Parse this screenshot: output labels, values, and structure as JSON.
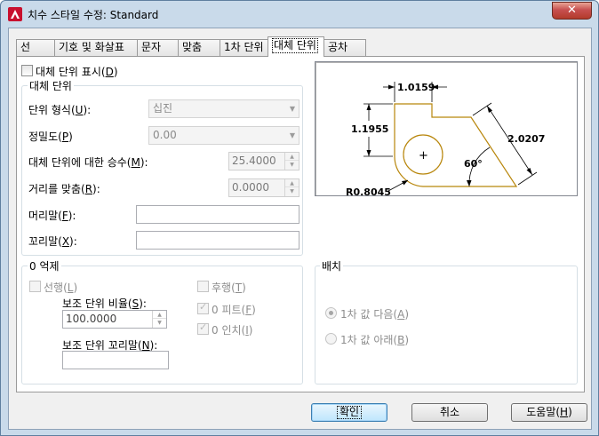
{
  "window": {
    "title": "치수 스타일 수정: Standard",
    "close_label": "✕",
    "accent_color": "#c9daea"
  },
  "tabs": [
    {
      "label": "선"
    },
    {
      "label": "기호 및 화살표"
    },
    {
      "label": "문자"
    },
    {
      "label": "맞춤"
    },
    {
      "label": "1차 단위"
    },
    {
      "label": "대체 단위",
      "active": true
    },
    {
      "label": "공차"
    }
  ],
  "alt_units": {
    "display_label": "대체 단위 표시(",
    "display_hotkey": "D",
    "display_checked": false,
    "group_title": "대체 단위",
    "unit_format_label": "단위 형식(",
    "unit_format_hotkey": "U",
    "unit_format_value": "십진",
    "precision_label": "정밀도(",
    "precision_hotkey": "P",
    "precision_value": "0.00",
    "multiplier_label": "대체 단위에 대한 승수(",
    "multiplier_hotkey": "M",
    "multiplier_value": "25.4000",
    "round_label": "거리를 맞춤(",
    "round_hotkey": "R",
    "round_value": "0.0000",
    "prefix_label": "머리말(",
    "prefix_hotkey": "F",
    "prefix_value": "",
    "suffix_label": "꼬리말(",
    "suffix_hotkey": "X",
    "suffix_value": ""
  },
  "zero_suppression": {
    "group_title": "0 억제",
    "leading_label": "선행(",
    "leading_hotkey": "L",
    "subunit_factor_label": "보조 단위 비율(",
    "subunit_factor_hotkey": "S",
    "subunit_factor_value": "100.0000",
    "subunit_suffix_label": "보조 단위 꼬리말(",
    "subunit_suffix_hotkey": "N",
    "subunit_suffix_value": "",
    "trailing_label": "후행(",
    "trailing_hotkey": "T",
    "feet_label": "0 피트(",
    "feet_hotkey": "F",
    "inches_label": "0 인치(",
    "inches_hotkey": "I"
  },
  "placement": {
    "group_title": "배치",
    "after_label": "1차 값 다음(",
    "after_hotkey": "A",
    "below_label": "1차 값 아래(",
    "below_hotkey": "B"
  },
  "preview": {
    "dim_top": "1.0159",
    "dim_left": "1.1955",
    "dim_right": "2.0207",
    "angle": "60°",
    "radius": "R0.8045",
    "center_mark": "+",
    "line_color": "#b8860b"
  },
  "buttons": {
    "ok": "확인",
    "cancel": "취소",
    "help_label": "도움말(",
    "help_hotkey": "H"
  }
}
